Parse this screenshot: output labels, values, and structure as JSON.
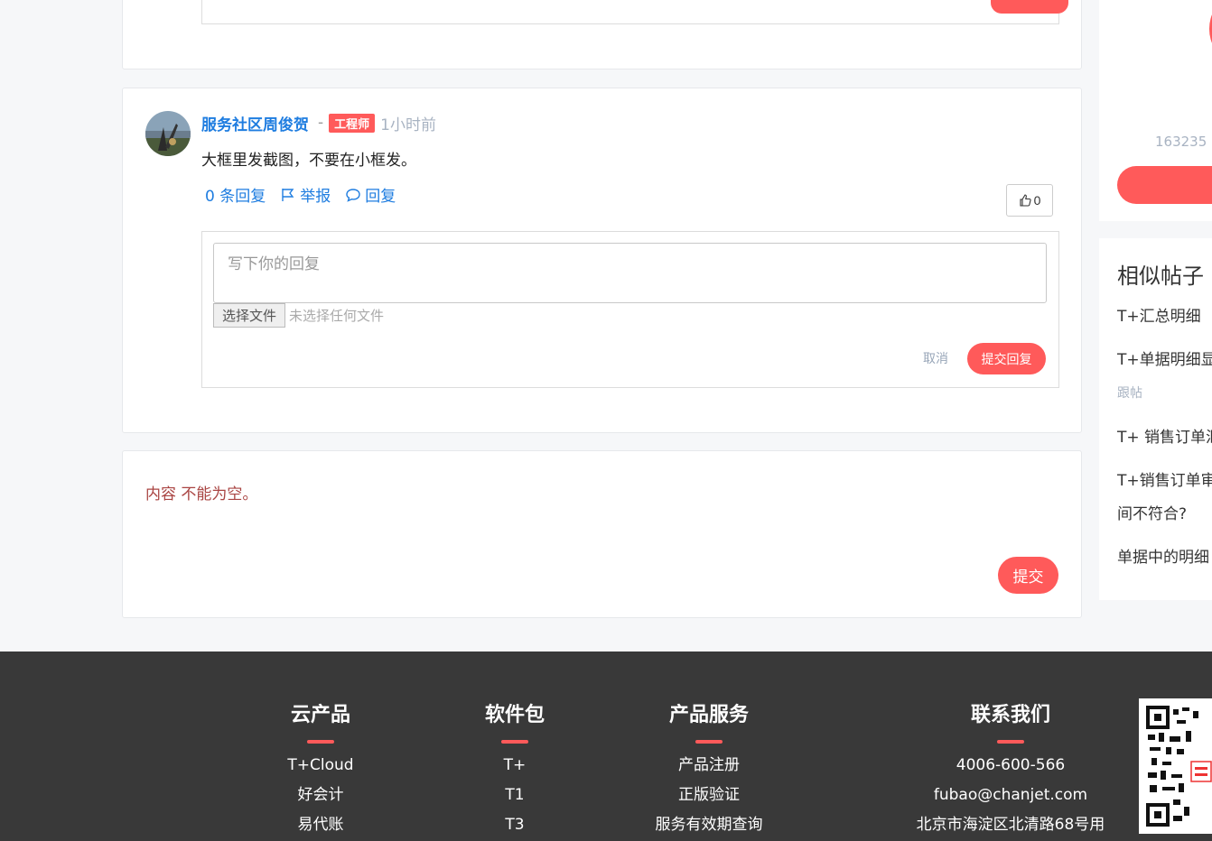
{
  "comment": {
    "author": "服务社区周俊贺",
    "separator": "-",
    "badge": "工程师",
    "time": "1小时前",
    "content": "大框里发截图，不要在小框发。",
    "replies_label": "0 条回复",
    "report_label": "举报",
    "reply_label": "回复",
    "likes": "0",
    "reply_form": {
      "placeholder": "写下你的回复",
      "file_button": "选择文件",
      "file_status": "未选择任何文件",
      "cancel": "取消",
      "submit": "提交回复"
    }
  },
  "post_reply": {
    "error": "内容 不能为空。",
    "submit": "提交"
  },
  "sidebar": {
    "count_text": "163235",
    "similar_title": "相似帖子",
    "similar_items": [
      "T+汇总明细",
      "T+单据明细显",
      "T+ 销售订单汇",
      "T+销售订单审",
      "间不符合?",
      "单据中的明细"
    ],
    "similar_sub": "跟帖"
  },
  "footer": {
    "columns": [
      {
        "title": "云产品",
        "links": [
          "T+Cloud",
          "好会计",
          "易代账"
        ]
      },
      {
        "title": "软件包",
        "links": [
          "T+",
          "T1",
          "T3"
        ]
      },
      {
        "title": "产品服务",
        "links": [
          "产品注册",
          "正版验证",
          "服务有效期查询"
        ]
      },
      {
        "title": "联系我们",
        "links": [
          "4006-600-566",
          "fubao@chanjet.com",
          "北京市海淀区北清路68号用"
        ]
      }
    ]
  },
  "colors": {
    "accent": "#ff5a5a",
    "link": "#1f7de0",
    "footer_bg": "#393939"
  }
}
